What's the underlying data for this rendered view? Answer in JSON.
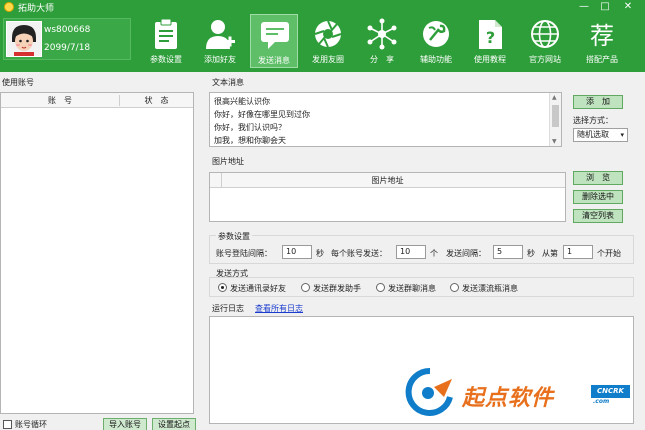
{
  "window": {
    "title": "拓助大师",
    "minimize": "—",
    "maximize": "□",
    "close": "✕"
  },
  "user": {
    "name": "ws800668",
    "date": "2099/7/18"
  },
  "nav": [
    {
      "label": "参数设置",
      "icon": "clipboard-icon",
      "active": false
    },
    {
      "label": "添加好友",
      "icon": "add-user-icon",
      "active": false
    },
    {
      "label": "发送消息",
      "icon": "chat-icon",
      "active": true
    },
    {
      "label": "发朋友圈",
      "icon": "camera-shutter-icon",
      "active": false
    },
    {
      "label": "分　享",
      "icon": "share-network-icon",
      "active": false
    },
    {
      "label": "辅助功能",
      "icon": "tool-icon",
      "active": false
    },
    {
      "label": "使用教程",
      "icon": "help-doc-icon",
      "active": false
    },
    {
      "label": "官方网站",
      "icon": "globe-icon",
      "active": false
    },
    {
      "label": "搭配产品",
      "icon": "recommend-icon",
      "active": false
    }
  ],
  "nav_recommend_glyph": "荐",
  "accounts": {
    "title": "使用账号",
    "col_account": "账　号",
    "col_status": "状　态",
    "loop_label": "账号循环",
    "import_button": "导入账号",
    "set_start_button": "设置起点"
  },
  "text_message": {
    "label": "文本消息",
    "lines": [
      "很高兴能认识你",
      "你好，好像在哪里见到过你",
      "你好，我们认识吗？",
      "加我，想和你聊会天"
    ],
    "add_button": "添　加",
    "select_mode_label": "选择方式：",
    "select_mode_value": "随机选取"
  },
  "image_address": {
    "label": "图片地址",
    "col_header": "图片地址",
    "browse_button": "浏　览",
    "delete_selected_button": "删除选中",
    "clear_list_button": "清空列表"
  },
  "params": {
    "label": "参数设置",
    "login_interval_label": "账号登陆间隔：",
    "login_interval_value": "10",
    "unit_seconds_1": "秒",
    "per_account_label": "每个账号发送：",
    "per_account_value": "10",
    "unit_count": "个",
    "send_interval_label": "发送间隔：",
    "send_interval_value": "5",
    "unit_seconds_2": "秒",
    "from_label": "从第",
    "from_value": "1",
    "start_label": "个开始"
  },
  "send_mode": {
    "label": "发送方式",
    "options": [
      "发送通讯录好友",
      "发送群发助手",
      "发送群聊消息",
      "发送漂流瓶消息"
    ],
    "selected_index": 0
  },
  "log": {
    "label": "运行日志",
    "view_all_link": "查看所有日志"
  },
  "watermark": {
    "text": "起点软件",
    "tag": "CNCRK",
    "url": ".com"
  },
  "colors": {
    "brand_green": "#2e9e3a",
    "button_green": "#bfe3bf",
    "link_blue": "#1a3ccf",
    "watermark_orange": "#e8701d",
    "watermark_blue": "#0f7dc9"
  }
}
